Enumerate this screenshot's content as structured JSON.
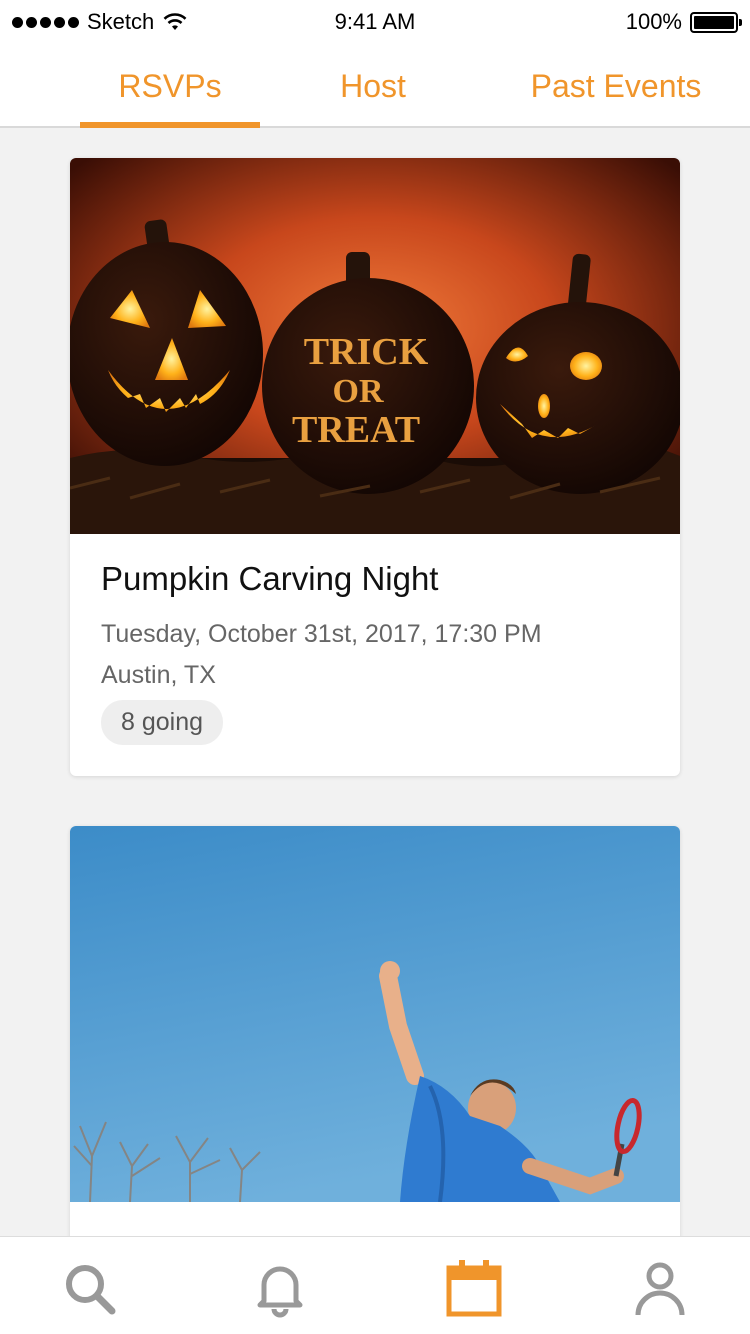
{
  "status_bar": {
    "carrier": "Sketch",
    "time": "9:41 AM",
    "battery": "100%"
  },
  "tabs": [
    {
      "label": "RSVPs",
      "active": true
    },
    {
      "label": "Host",
      "active": false
    },
    {
      "label": "Past Events",
      "active": false
    }
  ],
  "events": [
    {
      "title": "Pumpkin Carving Night",
      "date": "Tuesday, October 31st, 2017, 17:30 PM",
      "location": "Austin, TX",
      "going": "8 going",
      "image": "jack-o-lanterns"
    },
    {
      "image": "tennis-player-serving"
    }
  ],
  "bottom_nav": [
    {
      "icon": "search-icon",
      "active": false
    },
    {
      "icon": "bell-icon",
      "active": false
    },
    {
      "icon": "calendar-icon",
      "active": true
    },
    {
      "icon": "profile-icon",
      "active": false
    }
  ],
  "colors": {
    "accent": "#f0952b",
    "inactive_icon": "#999999",
    "background": "#f2f2f2"
  }
}
